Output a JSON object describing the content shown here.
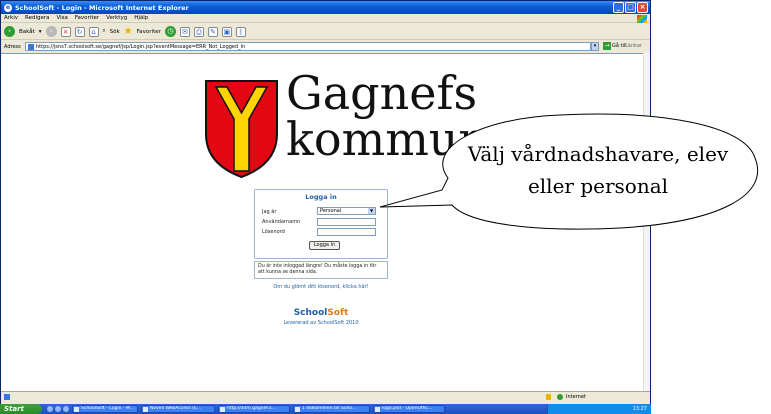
{
  "window": {
    "title": "SchoolSoft - Login - Microsoft Internet Explorer",
    "ie_icon": "e",
    "buttons": [
      "_",
      "□",
      "×"
    ]
  },
  "menu": [
    "Arkiv",
    "Redigera",
    "Visa",
    "Favoriter",
    "Verktyg",
    "Hjälp"
  ],
  "toolbar": {
    "back_label": "Bakåt",
    "search_label": "Sök",
    "favorites_label": "Favoriter"
  },
  "address": {
    "label": "Adress",
    "url": "https://jsns7.schoolsoft.se/gagnef/jsp/Login.jsp?eventMessage=ERR_Not_Logged_In",
    "go_label": "Gå till",
    "links_label": "Länkar"
  },
  "logo": {
    "line1": "Gagnefs",
    "line2": "kommun"
  },
  "login": {
    "title": "Logga in",
    "role_label": "Jag är",
    "role_value": "Personal",
    "username_label": "Användarnamn",
    "password_label": "Lösenord",
    "button": "Logga in",
    "message": "Du är inte inloggad längre! Du måste logga in för att kunna se denna sida.",
    "forgot": "Om du glömt ditt lösenord, klicka här!"
  },
  "brand": {
    "school": "School",
    "soft": "Soft",
    "credit": "Levererad av SchoolSoft 2010"
  },
  "status": {
    "zone": "Internet"
  },
  "taskbar": {
    "start": "Start",
    "tasks": [
      "SchoolSoft - Login - M...",
      "Novell WebAccess (E...",
      "http://adm.gagnef.s...",
      "1 Välkommen till Scho...",
      "logo.psd - OpenOffic..."
    ],
    "clock": "13:27"
  },
  "callout": {
    "line1": "Välj vårdnadshavare, elev",
    "line2": "eller personal"
  },
  "colors": {
    "shield_red": "#e30613",
    "shield_yellow": "#ffd400",
    "link_blue": "#2060a8",
    "soft_orange": "#e07c1a"
  }
}
